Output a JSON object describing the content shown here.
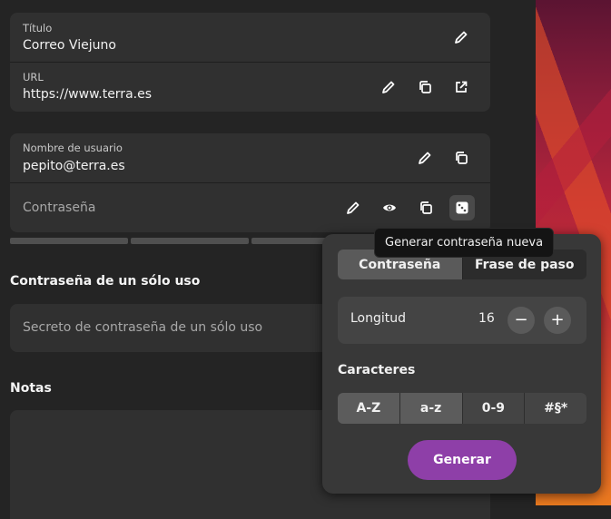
{
  "entry": {
    "title_label": "Título",
    "title_value": "Correo Viejuno",
    "url_label": "URL",
    "url_value": "https://www.terra.es",
    "username_label": "Nombre de usuario",
    "username_value": "pepito@terra.es",
    "password_placeholder": "Contraseña"
  },
  "otp": {
    "section_title": "Contraseña de un sólo uso",
    "placeholder": "Secreto de contraseña de un sólo uso"
  },
  "notes": {
    "section_title": "Notas"
  },
  "tooltip": "Generar contraseña nueva",
  "generator": {
    "mode_tabs": [
      {
        "label": "Contraseña",
        "selected": true
      },
      {
        "label": "Frase de paso",
        "selected": false
      }
    ],
    "length_label": "Longitud",
    "length_value": "16",
    "decrease": "−",
    "increase": "+",
    "characters_title": "Caracteres",
    "charsets": [
      {
        "label": "A-Z",
        "on": true
      },
      {
        "label": "a-z",
        "on": true
      },
      {
        "label": "0-9",
        "on": false
      },
      {
        "label": "#§*",
        "on": false
      }
    ],
    "generate_label": "Generar"
  },
  "colors": {
    "accent": "#8e3fa8",
    "card": "#303030",
    "background": "#242424"
  }
}
